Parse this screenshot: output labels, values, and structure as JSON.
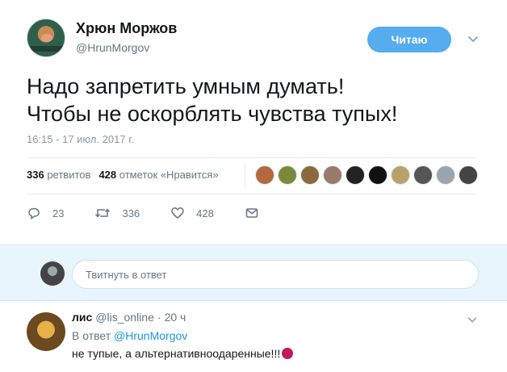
{
  "tweet": {
    "author_name": "Хрюн Моржов",
    "author_handle": "@HrunMorgov",
    "follow_label": "Читаю",
    "text_line1": "Надо запретить умным думать!",
    "text_line2": "Чтобы не оскорблять чувства тупых!",
    "timestamp": "16:15 - 17 июл. 2017 г.",
    "retweets_count": "336",
    "retweets_label": "ретвитов",
    "likes_count": "428",
    "likes_label": "отметок «Нравится»",
    "liker_colors": [
      "#b5673d",
      "#7b8a3a",
      "#8a6a3a",
      "#9a7a6a",
      "#222222",
      "#111111",
      "#b9a26a",
      "#555555",
      "#9aa5b0",
      "#444444"
    ],
    "actions": {
      "reply_count": "23",
      "retweet_count": "336",
      "like_count": "428"
    }
  },
  "reply_box": {
    "placeholder": "Твитнуть в ответ"
  },
  "reply": {
    "name": "лис",
    "handle": "@lis_online",
    "separator": "·",
    "time": "20 ч",
    "reply_to_label": "В ответ",
    "reply_to_handle": "@HrunMorgov",
    "text": "не тупые, а альтернативноодаренные!!!"
  },
  "colors": {
    "accent": "#55acee",
    "link": "#1b95e0",
    "muted": "#657786",
    "reply_bg": "#e8f5fd"
  }
}
